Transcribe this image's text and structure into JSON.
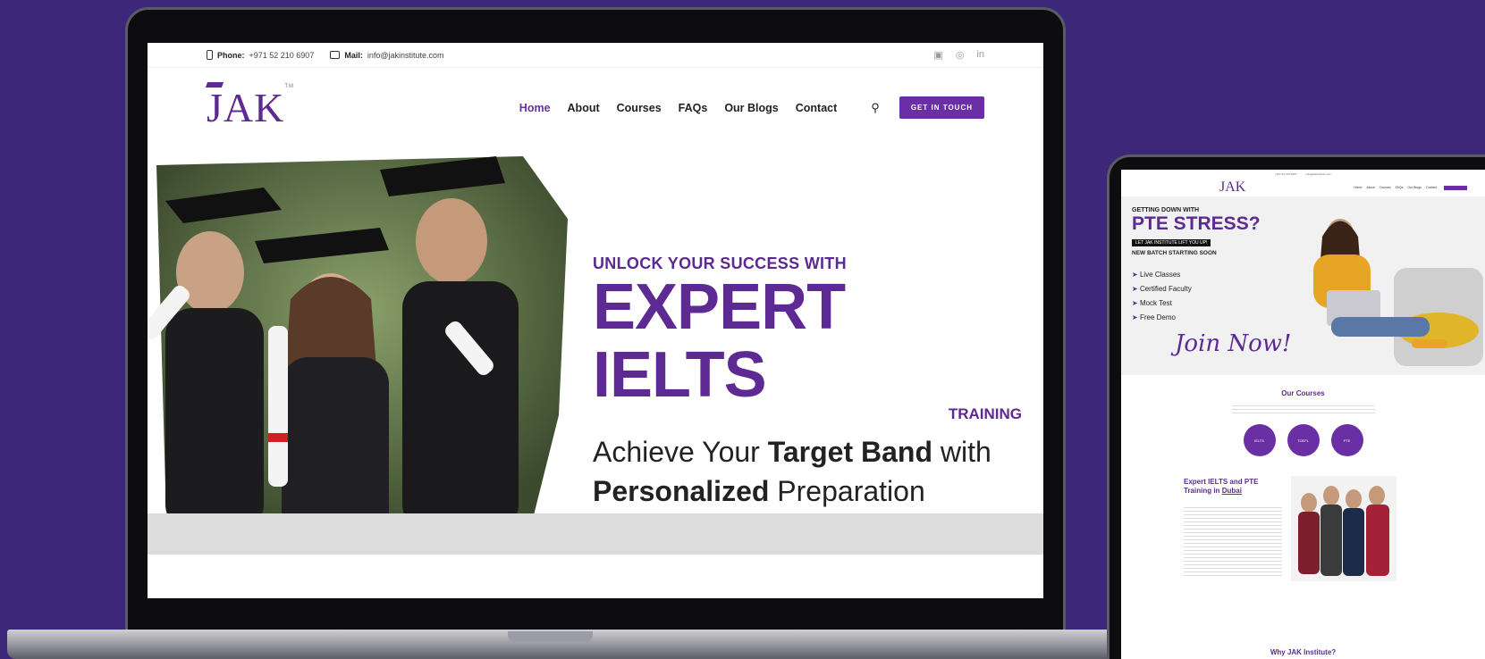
{
  "topbar": {
    "phone_label": "Phone:",
    "phone_value": "+971 52 210 6907",
    "mail_label": "Mail:",
    "mail_value": "info@jakinstitute.com"
  },
  "brand": {
    "logo": "JAK",
    "tm": "TM"
  },
  "nav": {
    "items": [
      "Home",
      "About",
      "Courses",
      "FAQs",
      "Our Blogs",
      "Contact"
    ],
    "cta": "GET IN TOUCH"
  },
  "hero": {
    "line1": "UNLOCK YOUR SUCCESS WITH",
    "line2": "EXPERT IELTS",
    "line3": "TRAINING",
    "sub_a": "Achieve Your ",
    "sub_b": "Target Band",
    "sub_c": " with",
    "sub_d": "Personalized",
    "sub_e": " Preparation"
  },
  "tablet": {
    "hero_small": "GETTING DOWN WITH",
    "hero_big": "PTE STRESS?",
    "pill": "LET JAK INSTITUTE LIFT YOU UP!",
    "batch": "NEW BATCH STARTING SOON",
    "features": [
      "Live Classes",
      "Certified Faculty",
      "Mock Test",
      "Free Demo"
    ],
    "join": "Join Now!",
    "courses_title": "Our Courses",
    "course_buttons": [
      "IELTS",
      "TOEFL",
      "PTE"
    ],
    "expert_title": "Expert IELTS and PTE Training in",
    "expert_city": "Dubai",
    "why": "Why JAK Institute?"
  },
  "colors": {
    "brand_purple": "#5c2a92",
    "background": "#3d2778"
  }
}
